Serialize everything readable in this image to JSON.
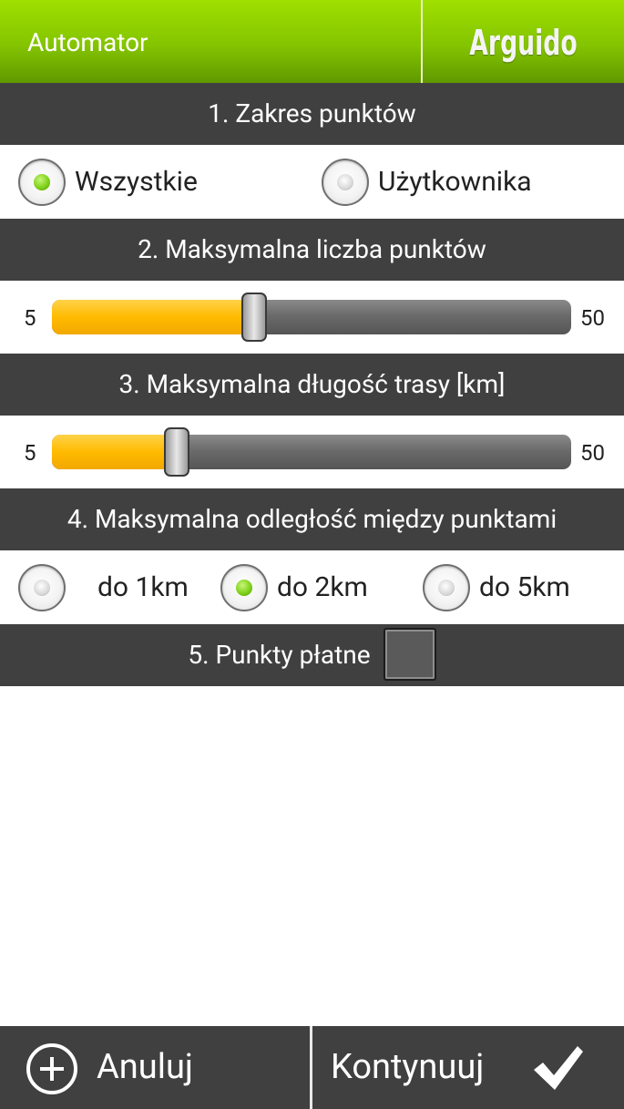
{
  "header": {
    "title": "Automator",
    "brand": "Arguido"
  },
  "sections": {
    "s1": "1. Zakres punktów",
    "s2": "2. Maksymalna liczba punktów",
    "s3": "3. Maksymalna długość trasy [km]",
    "s4": "4. Maksymalna odległość między punktami",
    "s5": "5. Punkty płatne"
  },
  "range": {
    "options": [
      {
        "label": "Wszystkie",
        "selected": true
      },
      {
        "label": "Użytkownika",
        "selected": false
      }
    ]
  },
  "max_points": {
    "min": "5",
    "max": "50",
    "value_fraction": 0.39
  },
  "max_length": {
    "min": "5",
    "max": "50",
    "value_fraction": 0.24
  },
  "distance": {
    "options": [
      {
        "label": "do 1km",
        "selected": false
      },
      {
        "label": "do 2km",
        "selected": true
      },
      {
        "label": "do 5km",
        "selected": false
      }
    ]
  },
  "paid_points": {
    "checked": false
  },
  "footer": {
    "cancel_label": "Anuluj",
    "continue_label": "Kontynuuj"
  },
  "colors": {
    "accent_green": "#84c400",
    "slider_fill": "#ffbb00",
    "section_bg": "#404040"
  }
}
